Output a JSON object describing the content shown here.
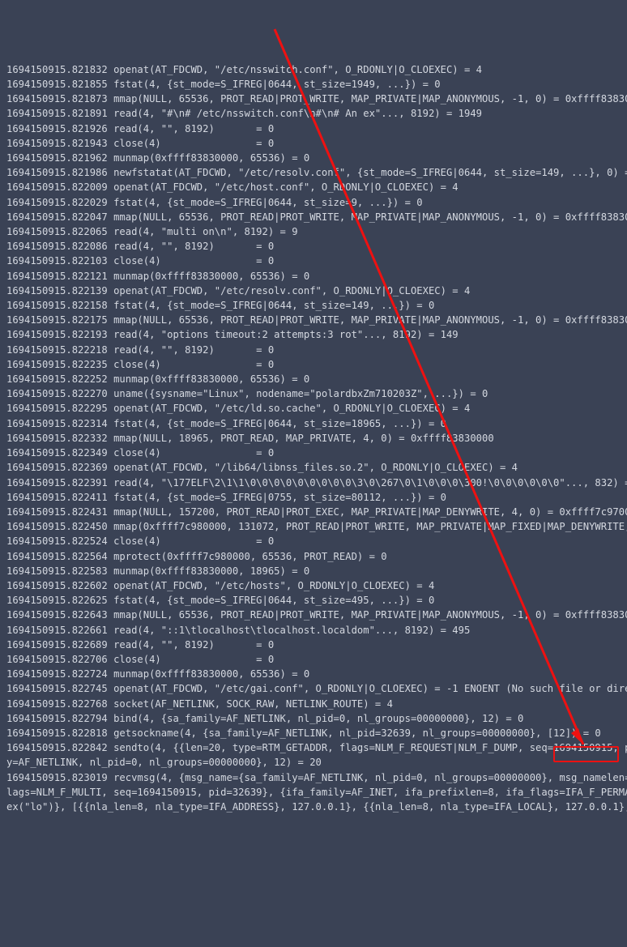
{
  "lines": [
    "1694150915.821832 openat(AT_FDCWD, \"/etc/nsswitch.conf\", O_RDONLY|O_CLOEXEC) = 4",
    "1694150915.821855 fstat(4, {st_mode=S_IFREG|0644, st_size=1949, ...}) = 0",
    "1694150915.821873 mmap(NULL, 65536, PROT_READ|PROT_WRITE, MAP_PRIVATE|MAP_ANONYMOUS, -1, 0) = 0xffff838300",
    "1694150915.821891 read(4, \"#\\n# /etc/nsswitch.conf\\n#\\n# An ex\"..., 8192) = 1949",
    "1694150915.821926 read(4, \"\", 8192)       = 0",
    "1694150915.821943 close(4)                = 0",
    "1694150915.821962 munmap(0xffff83830000, 65536) = 0",
    "1694150915.821986 newfstatat(AT_FDCWD, \"/etc/resolv.conf\", {st_mode=S_IFREG|0644, st_size=149, ...}, 0) =",
    "1694150915.822009 openat(AT_FDCWD, \"/etc/host.conf\", O_RDONLY|O_CLOEXEC) = 4",
    "1694150915.822029 fstat(4, {st_mode=S_IFREG|0644, st_size=9, ...}) = 0",
    "1694150915.822047 mmap(NULL, 65536, PROT_READ|PROT_WRITE, MAP_PRIVATE|MAP_ANONYMOUS, -1, 0) = 0xffff838300",
    "1694150915.822065 read(4, \"multi on\\n\", 8192) = 9",
    "1694150915.822086 read(4, \"\", 8192)       = 0",
    "1694150915.822103 close(4)                = 0",
    "1694150915.822121 munmap(0xffff83830000, 65536) = 0",
    "1694150915.822139 openat(AT_FDCWD, \"/etc/resolv.conf\", O_RDONLY|O_CLOEXEC) = 4",
    "1694150915.822158 fstat(4, {st_mode=S_IFREG|0644, st_size=149, ...}) = 0",
    "1694150915.822175 mmap(NULL, 65536, PROT_READ|PROT_WRITE, MAP_PRIVATE|MAP_ANONYMOUS, -1, 0) = 0xffff838300",
    "1694150915.822193 read(4, \"options timeout:2 attempts:3 rot\"..., 8192) = 149",
    "1694150915.822218 read(4, \"\", 8192)       = 0",
    "1694150915.822235 close(4)                = 0",
    "1694150915.822252 munmap(0xffff83830000, 65536) = 0",
    "1694150915.822270 uname({sysname=\"Linux\", nodename=\"polardbxZm710203Z\", ...}) = 0",
    "1694150915.822295 openat(AT_FDCWD, \"/etc/ld.so.cache\", O_RDONLY|O_CLOEXEC) = 4",
    "1694150915.822314 fstat(4, {st_mode=S_IFREG|0644, st_size=18965, ...}) = 0",
    "1694150915.822332 mmap(NULL, 18965, PROT_READ, MAP_PRIVATE, 4, 0) = 0xffff83830000",
    "1694150915.822349 close(4)                = 0",
    "1694150915.822369 openat(AT_FDCWD, \"/lib64/libnss_files.so.2\", O_RDONLY|O_CLOEXEC) = 4",
    "1694150915.822391 read(4, \"\\177ELF\\2\\1\\1\\0\\0\\0\\0\\0\\0\\0\\0\\0\\3\\0\\267\\0\\1\\0\\0\\0\\300!\\0\\0\\0\\0\\0\\0\"..., 832) =",
    "1694150915.822411 fstat(4, {st_mode=S_IFREG|0755, st_size=80112, ...}) = 0",
    "1694150915.822431 mmap(NULL, 157200, PROT_READ|PROT_EXEC, MAP_PRIVATE|MAP_DENYWRITE, 4, 0) = 0xffff7c97000",
    "1694150915.822450 mmap(0xffff7c980000, 131072, PROT_READ|PROT_WRITE, MAP_PRIVATE|MAP_FIXED|MAP_DENYWRITE,",
    "1694150915.822524 close(4)                = 0",
    "1694150915.822564 mprotect(0xffff7c980000, 65536, PROT_READ) = 0",
    "1694150915.822583 munmap(0xffff83830000, 18965) = 0",
    "1694150915.822602 openat(AT_FDCWD, \"/etc/hosts\", O_RDONLY|O_CLOEXEC) = 4",
    "1694150915.822625 fstat(4, {st_mode=S_IFREG|0644, st_size=495, ...}) = 0",
    "1694150915.822643 mmap(NULL, 65536, PROT_READ|PROT_WRITE, MAP_PRIVATE|MAP_ANONYMOUS, -1, 0) = 0xffff838300",
    "1694150915.822661 read(4, \"::1\\tlocalhost\\tlocalhost.localdom\"..., 8192) = 495",
    "1694150915.822689 read(4, \"\", 8192)       = 0",
    "1694150915.822706 close(4)                = 0",
    "1694150915.822724 munmap(0xffff83830000, 65536) = 0",
    "1694150915.822745 openat(AT_FDCWD, \"/etc/gai.conf\", O_RDONLY|O_CLOEXEC) = -1 ENOENT (No such file or direc",
    "1694150915.822768 socket(AF_NETLINK, SOCK_RAW, NETLINK_ROUTE) = 4",
    "1694150915.822794 bind(4, {sa_family=AF_NETLINK, nl_pid=0, nl_groups=00000000}, 12) = 0",
    "1694150915.822818 getsockname(4, {sa_family=AF_NETLINK, nl_pid=32639, nl_groups=00000000}, [12]) = 0",
    "1694150915.822842 sendto(4, {{len=20, type=RTM_GETADDR, flags=NLM_F_REQUEST|NLM_F_DUMP, seq=1694150915, pi",
    "y=AF_NETLINK, nl_pid=0, nl_groups=00000000}, 12) = 20",
    "1694150915.823019 recvmsg(4, {msg_name={sa_family=AF_NETLINK, nl_pid=0, nl_groups=00000000}, msg_namelen=1",
    "lags=NLM_F_MULTI, seq=1694150915, pid=32639}, {ifa_family=AF_INET, ifa_prefixlen=8, ifa_flags=IFA_F_PERMAN",
    "ex(\"lo\")}, [{{nla_len=8, nla_type=IFA_ADDRESS}, 127.0.0.1}, {{nla_len=8, nla_type=IFA_LOCAL}, 127.0.0.1},"
  ],
  "highlight": {
    "ip": "127.0.0.1"
  }
}
